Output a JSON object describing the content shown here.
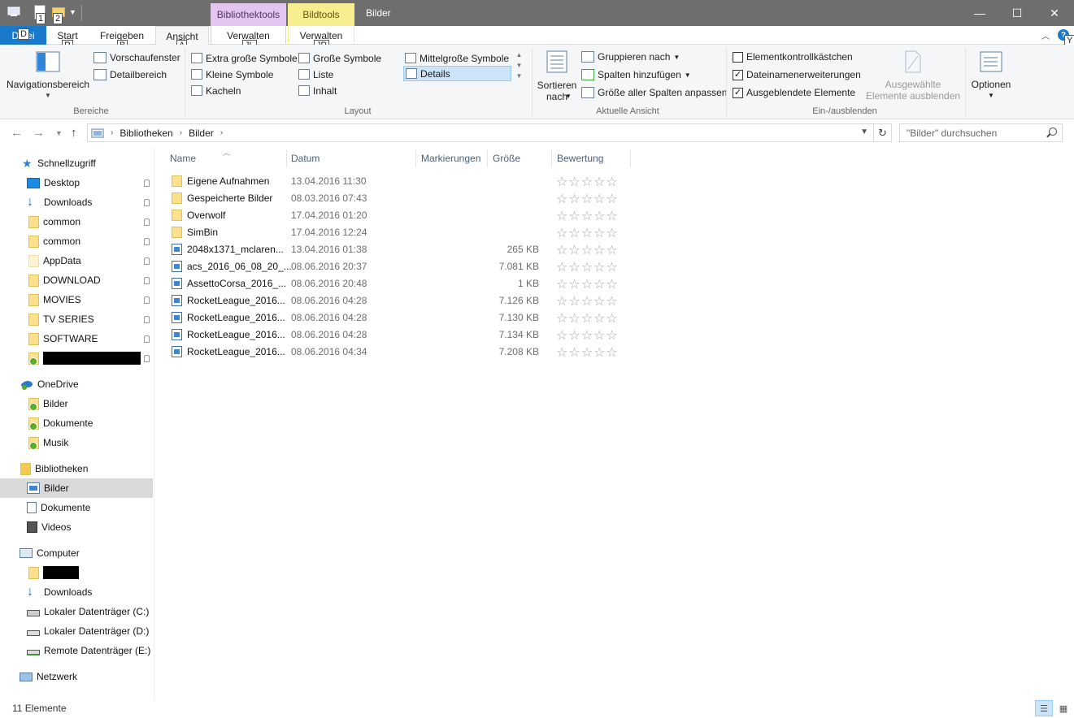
{
  "titlebar": {
    "title": "Bilder",
    "context_tab_library": "Bibliothektools",
    "context_tab_picture": "Bildtools",
    "qa_keytip_1": "1",
    "qa_keytip_2": "2",
    "minimize": "—",
    "maximize": "☐",
    "close": "✕"
  },
  "tabs": {
    "file_label": "Datei",
    "file_keytip": "D",
    "start": "Start",
    "share": "Freigeben",
    "view": "Ansicht",
    "manage_library": "Verwalten",
    "manage_picture": "Verwalten",
    "keytip_start": "R",
    "keytip_share": "B",
    "keytip_view": "A",
    "keytip_manage_library": "JL",
    "keytip_manage_picture": "JP",
    "help_keytip": "Y"
  },
  "ribbon": {
    "panes": {
      "navigation_pane": "Navigationsbereich",
      "preview_pane": "Vorschaufenster",
      "details_pane": "Detailbereich",
      "label": "Bereiche"
    },
    "layout": {
      "items": [
        "Extra große Symbole",
        "Große Symbole",
        "Mittelgroße Symbole",
        "Kleine Symbole",
        "Liste",
        "Details",
        "Kacheln",
        "Inhalt"
      ],
      "selected": "Details",
      "label": "Layout"
    },
    "current_view": {
      "sort_line1": "Sortieren",
      "sort_line2": "nach",
      "group_by": "Gruppieren nach",
      "add_columns": "Spalten hinzufügen",
      "size_columns": "Größe aller Spalten anpassen",
      "label": "Aktuelle Ansicht"
    },
    "show_hide": {
      "item_checkboxes": "Elementkontrollkästchen",
      "item_checkboxes_checked": false,
      "extensions": "Dateinamenerweiterungen",
      "extensions_checked": true,
      "hidden_items": "Ausgeblendete Elemente",
      "hidden_items_checked": true,
      "hide_selected_line1": "Ausgewählte",
      "hide_selected_line2": "Elemente ausblenden",
      "label": "Ein-/ausblenden"
    },
    "options": "Optionen"
  },
  "address": {
    "crumbs": [
      "Bibliotheken",
      "Bilder"
    ],
    "search_placeholder": "\"Bilder\" durchsuchen"
  },
  "navpane": {
    "quick_access": "Schnellzugriff",
    "quick_items": [
      "Desktop",
      "Downloads",
      "common",
      "common",
      "AppData",
      "DOWNLOAD",
      "MOVIES",
      "TV SERIES",
      "SOFTWARE"
    ],
    "onedrive": "OneDrive",
    "onedrive_items": [
      "Bilder",
      "Dokumente",
      "Musik"
    ],
    "libraries": "Bibliotheken",
    "library_items": [
      "Bilder",
      "Dokumente",
      "Videos"
    ],
    "computer": "Computer",
    "computer_items": [
      "Downloads",
      "Lokaler Datenträger (C:)",
      "Lokaler Datenträger (D:)",
      "Remote Datenträger (E:)"
    ],
    "network": "Netzwerk"
  },
  "columns": {
    "name": "Name",
    "date": "Datum",
    "tags": "Markierungen",
    "size": "Größe",
    "rating": "Bewertung"
  },
  "files": [
    {
      "type": "folder",
      "name": "Eigene Aufnahmen",
      "date": "13.04.2016 11:30",
      "size": ""
    },
    {
      "type": "folder",
      "name": "Gespeicherte Bilder",
      "date": "08.03.2016 07:43",
      "size": ""
    },
    {
      "type": "folder",
      "name": "Overwolf",
      "date": "17.04.2016 01:20",
      "size": ""
    },
    {
      "type": "folder",
      "name": "SimBin",
      "date": "17.04.2016 12:24",
      "size": ""
    },
    {
      "type": "image",
      "name": "2048x1371_mclaren...",
      "date": "13.04.2016 01:38",
      "size": "265 KB"
    },
    {
      "type": "image",
      "name": "acs_2016_06_08_20_...",
      "date": "08.06.2016 20:37",
      "size": "7.081 KB"
    },
    {
      "type": "image",
      "name": "AssettoCorsa_2016_...",
      "date": "08.06.2016 20:48",
      "size": "1 KB"
    },
    {
      "type": "image",
      "name": "RocketLeague_2016...",
      "date": "08.06.2016 04:28",
      "size": "7.126 KB"
    },
    {
      "type": "image",
      "name": "RocketLeague_2016...",
      "date": "08.06.2016 04:28",
      "size": "7.130 KB"
    },
    {
      "type": "image",
      "name": "RocketLeague_2016...",
      "date": "08.06.2016 04:28",
      "size": "7.134 KB"
    },
    {
      "type": "image",
      "name": "RocketLeague_2016...",
      "date": "08.06.2016 04:34",
      "size": "7.208 KB"
    }
  ],
  "rating_stars": "☆☆☆☆☆",
  "status": {
    "count": "11 Elemente"
  },
  "colors": {
    "file_tab": "#1979ca",
    "library_tools": "#e3c6ef",
    "picture_tools": "#f6ee8f",
    "titlebar": "#6e6e6e",
    "selection": "#cce4f7"
  }
}
